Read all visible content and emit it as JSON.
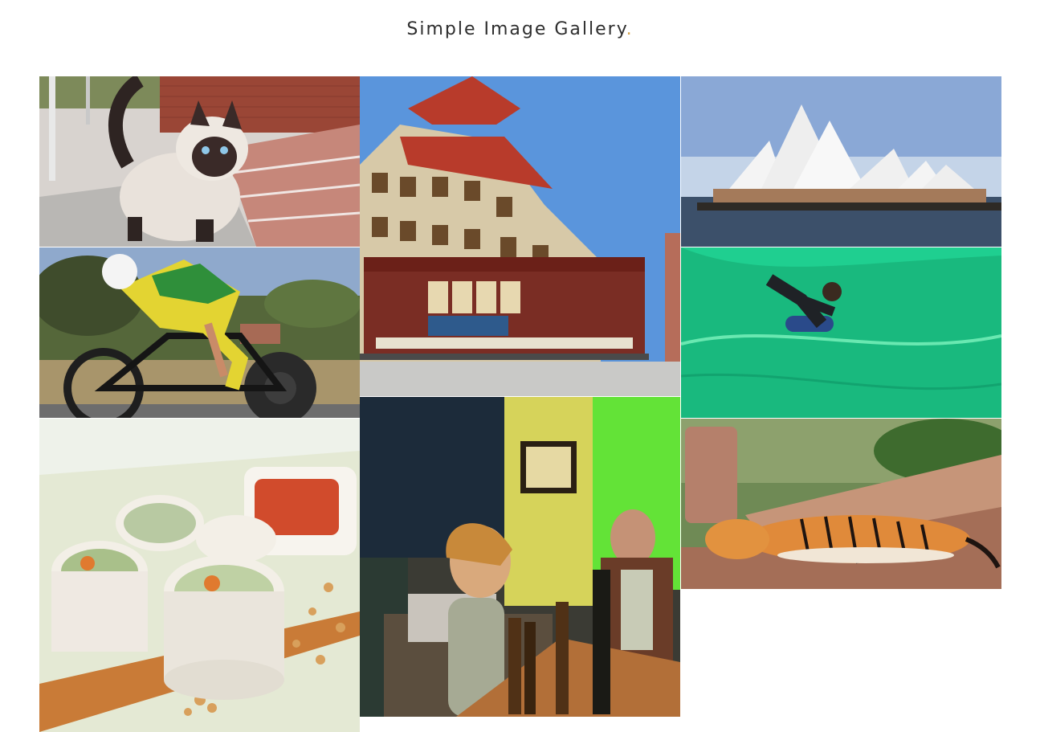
{
  "header": {
    "title": "Simple Image Gallery",
    "title_dot": "."
  },
  "colors": {
    "accent": "#d4a24a",
    "title_text": "#2e2e2e"
  },
  "gallery": {
    "images": [
      {
        "subject": "Siamese cat on stairs",
        "icon": "cat-photo"
      },
      {
        "subject": "Cyclist racing on time trial bike",
        "icon": "cyclist-photo"
      },
      {
        "subject": "Spring rolls with dipping sauce",
        "icon": "sushi-photo"
      },
      {
        "subject": "Cable car in Chinatown",
        "icon": "cable-car-photo"
      },
      {
        "subject": "People at a bar",
        "icon": "bar-photo"
      },
      {
        "subject": "Sydney Opera House",
        "icon": "opera-house-photo"
      },
      {
        "subject": "Bodyboarder in green wave",
        "icon": "surfer-photo"
      },
      {
        "subject": "Tiger lying on stone ledge",
        "icon": "tiger-photo"
      }
    ]
  }
}
